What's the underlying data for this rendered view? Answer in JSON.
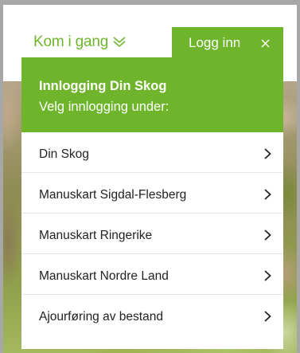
{
  "topbar": {
    "kom_i_gang_label": "Kom i gang",
    "kom_i_gang_icon": "double-chevron-down-icon",
    "login_label": "Logg inn",
    "login_close_icon": "close-icon"
  },
  "panel": {
    "title": "Innlogging Din Skog",
    "subtitle": "Velg innlogging under:",
    "items": [
      {
        "label": "Din Skog",
        "icon": "chevron-right-icon"
      },
      {
        "label": "Manuskart Sigdal-Flesberg",
        "icon": "chevron-right-icon"
      },
      {
        "label": "Manuskart Ringerike",
        "icon": "chevron-right-icon"
      },
      {
        "label": "Manuskart Nordre Land",
        "icon": "chevron-right-icon"
      },
      {
        "label": "Ajourføring av bestand",
        "icon": "chevron-right-icon"
      }
    ]
  },
  "colors": {
    "accent_green": "#6fb52c",
    "text_dark": "#222222",
    "white": "#ffffff"
  }
}
